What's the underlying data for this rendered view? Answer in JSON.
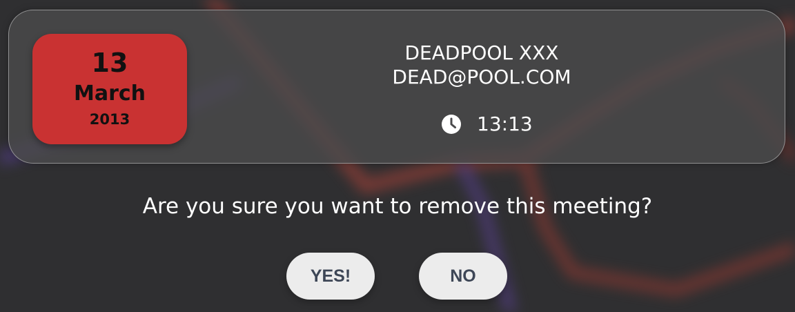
{
  "meeting": {
    "date": {
      "day": "13",
      "month": "March",
      "year": "2013",
      "badge_color": "#c93232"
    },
    "name": "DEADPOOL XXX",
    "email": "DEAD@POOL.COM",
    "time": "13:13",
    "time_icon": "clock-icon"
  },
  "dialog": {
    "prompt": "Are you sure you want to remove this meeting?",
    "yes_label": "YES!",
    "no_label": "NO"
  },
  "colors": {
    "background": "#2f2f31",
    "card_background": "#4a4a4c",
    "button_background": "#ececec",
    "button_text": "#3d4656"
  }
}
